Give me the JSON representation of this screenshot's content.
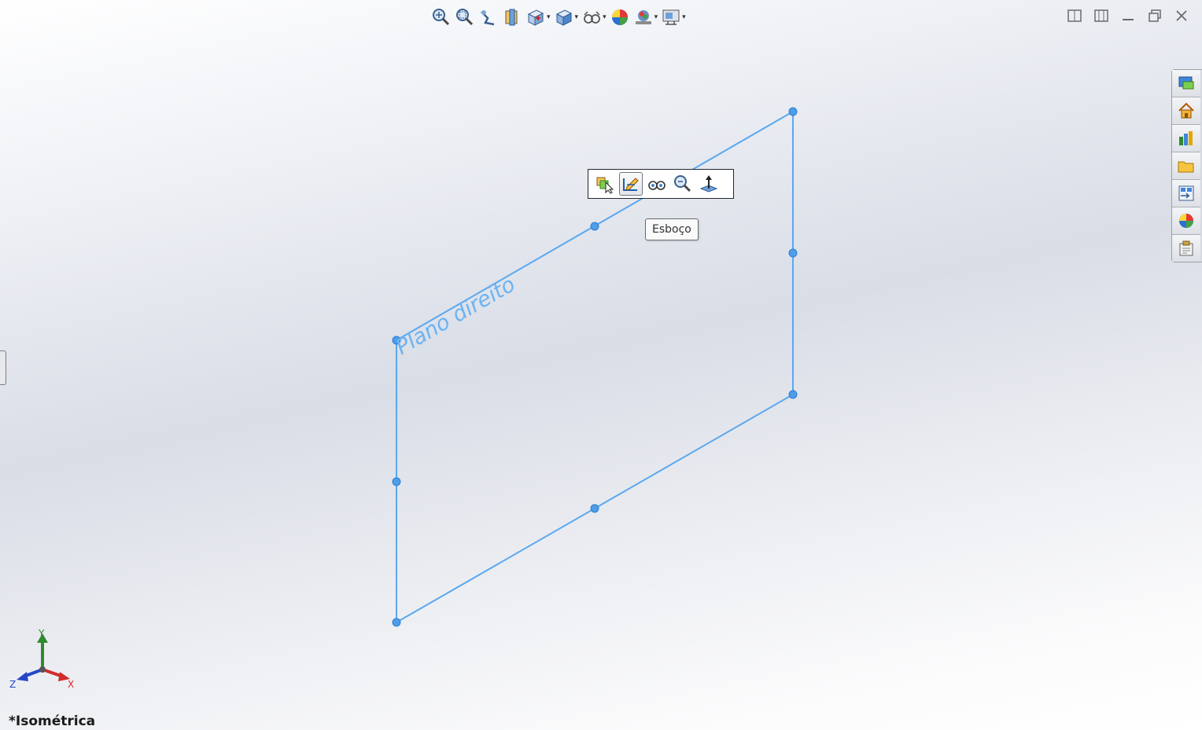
{
  "heads_up_toolbar": {
    "items": [
      {
        "icon": "zoom-to-fit-icon",
        "has_dropdown": false
      },
      {
        "icon": "zoom-to-area-icon",
        "has_dropdown": false
      },
      {
        "icon": "previous-view-icon",
        "has_dropdown": false
      },
      {
        "icon": "section-view-icon",
        "has_dropdown": false
      },
      {
        "icon": "view-orientation-icon",
        "has_dropdown": true
      },
      {
        "icon": "display-style-icon",
        "has_dropdown": true
      },
      {
        "icon": "hide-show-items-icon",
        "has_dropdown": true
      },
      {
        "icon": "edit-appearance-icon",
        "has_dropdown": false
      },
      {
        "icon": "apply-scene-icon",
        "has_dropdown": true
      },
      {
        "icon": "view-settings-icon",
        "has_dropdown": true
      }
    ],
    "dropdown_caret": "▾"
  },
  "window_controls": [
    "tile-horizontal-icon",
    "tile-vertical-icon",
    "minimize-icon",
    "restore-icon",
    "close-icon"
  ],
  "task_pane": {
    "tabs": [
      "solidworks-resources-icon",
      "home-icon",
      "design-library-icon",
      "file-explorer-icon",
      "view-palette-icon",
      "appearances-icon",
      "custom-properties-icon"
    ]
  },
  "plane": {
    "label": "Plano direito",
    "color": "#5aa8f0"
  },
  "context_toolbar": {
    "buttons": [
      "select-other-icon",
      "sketch-icon",
      "hide-show-icon",
      "zoom-to-selection-icon",
      "normal-to-icon"
    ],
    "active_index": 1,
    "tooltip": "Esboço"
  },
  "triad": {
    "x_label": "X",
    "y_label": "Y",
    "z_label": "Z"
  },
  "view": {
    "orientation_label": "*Isométrica"
  },
  "colors": {
    "plane": "#5aa8f0",
    "axis_x": "#d22b2b",
    "axis_y": "#2f8a2f",
    "axis_z": "#2446c8"
  }
}
